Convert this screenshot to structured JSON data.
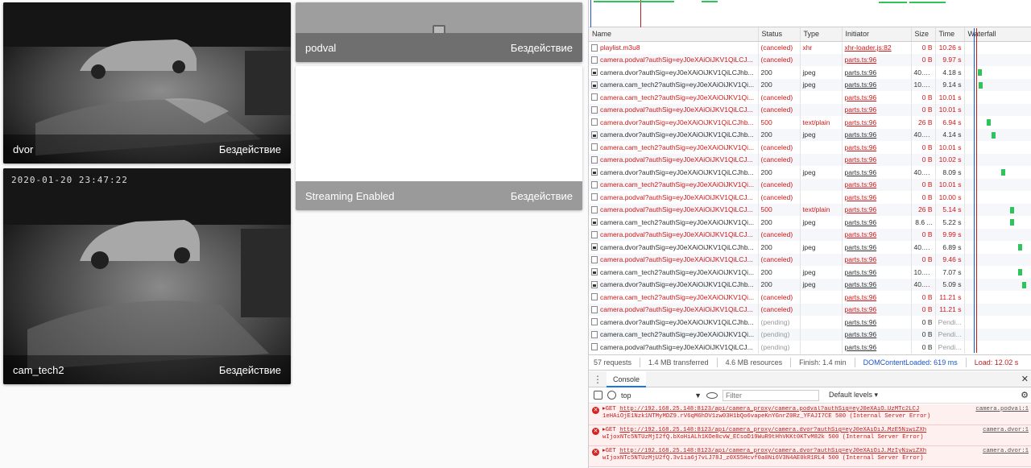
{
  "cameras": {
    "dvor": {
      "name": "dvor",
      "state": "Бездействие"
    },
    "cam_tech2": {
      "name": "cam_tech2",
      "state": "Бездействие",
      "timestamp": "2020-01-20 23:47:22"
    },
    "podval": {
      "name": "podval",
      "state": "Бездействие"
    },
    "streaming": {
      "name": "Streaming Enabled",
      "state": "Бездействие"
    }
  },
  "network": {
    "columns": [
      "Name",
      "Status",
      "Type",
      "Initiator",
      "Size",
      "Time",
      "Waterfall"
    ],
    "rows": [
      {
        "name": "playlist.m3u8",
        "status": "(canceled)",
        "type": "xhr",
        "initiator": "xhr-loader.js:82",
        "size": "0 B",
        "time": "10.26 s",
        "error": true,
        "icon": "doc-icon",
        "bar": null
      },
      {
        "name": "camera.podval?authSig=eyJ0eXAiOiJKV1QiLCJ...",
        "status": "(canceled)",
        "type": "",
        "initiator": "parts.ts:96",
        "size": "0 B",
        "time": "9.97 s",
        "error": true,
        "icon": "doc-icon",
        "bar": null
      },
      {
        "name": "camera.dvor?authSig=eyJ0eXAiOiJKV1QiLCJhb...",
        "status": "200",
        "type": "jpeg",
        "initiator": "parts.ts:96",
        "size": "40.6...",
        "time": "4.18 s",
        "error": false,
        "icon": "image-icon",
        "bar": 0.2
      },
      {
        "name": "camera.cam_tech2?authSig=eyJ0eXAiOiJKV1Qi...",
        "status": "200",
        "type": "jpeg",
        "initiator": "parts.ts:96",
        "size": "10.1...",
        "time": "9.14 s",
        "error": false,
        "icon": "image-icon",
        "bar": 0.21
      },
      {
        "name": "camera.cam_tech2?authSig=eyJ0eXAiOiJKV1Qi...",
        "status": "(canceled)",
        "type": "",
        "initiator": "parts.ts:96",
        "size": "0 B",
        "time": "10.01 s",
        "error": true,
        "icon": "doc-icon",
        "bar": null
      },
      {
        "name": "camera.podval?authSig=eyJ0eXAiOiJKV1QiLCJ...",
        "status": "(canceled)",
        "type": "",
        "initiator": "parts.ts:96",
        "size": "0 B",
        "time": "10.01 s",
        "error": true,
        "icon": "doc-icon",
        "bar": null
      },
      {
        "name": "camera.dvor?authSig=eyJ0eXAiOiJKV1QiLCJhb...",
        "status": "500",
        "type": "text/plain",
        "initiator": "parts.ts:96",
        "size": "26 B",
        "time": "6.94 s",
        "error": true,
        "icon": "doc-icon",
        "bar": 0.34
      },
      {
        "name": "camera.dvor?authSig=eyJ0eXAiOiJKV1QiLCJhb...",
        "status": "200",
        "type": "jpeg",
        "initiator": "parts.ts:96",
        "size": "40.5...",
        "time": "4.14 s",
        "error": false,
        "icon": "image-icon",
        "bar": 0.41
      },
      {
        "name": "camera.cam_tech2?authSig=eyJ0eXAiOiJKV1Qi...",
        "status": "(canceled)",
        "type": "",
        "initiator": "parts.ts:96",
        "size": "0 B",
        "time": "10.01 s",
        "error": true,
        "icon": "doc-icon",
        "bar": null
      },
      {
        "name": "camera.podval?authSig=eyJ0eXAiOiJKV1QiLCJ...",
        "status": "(canceled)",
        "type": "",
        "initiator": "parts.ts:96",
        "size": "0 B",
        "time": "10.02 s",
        "error": true,
        "icon": "doc-icon",
        "bar": null
      },
      {
        "name": "camera.dvor?authSig=eyJ0eXAiOiJKV1QiLCJhb...",
        "status": "200",
        "type": "jpeg",
        "initiator": "parts.ts:96",
        "size": "40.4...",
        "time": "8.09 s",
        "error": false,
        "icon": "image-icon",
        "bar": 0.56
      },
      {
        "name": "camera.cam_tech2?authSig=eyJ0eXAiOiJKV1Qi...",
        "status": "(canceled)",
        "type": "",
        "initiator": "parts.ts:96",
        "size": "0 B",
        "time": "10.01 s",
        "error": true,
        "icon": "doc-icon",
        "bar": null
      },
      {
        "name": "camera.podval?authSig=eyJ0eXAiOiJKV1QiLCJ...",
        "status": "(canceled)",
        "type": "",
        "initiator": "parts.ts:96",
        "size": "0 B",
        "time": "10.00 s",
        "error": true,
        "icon": "doc-icon",
        "bar": null
      },
      {
        "name": "camera.podval?authSig=eyJ0eXAiOiJKV1QiLCJ...",
        "status": "500",
        "type": "text/plain",
        "initiator": "parts.ts:96",
        "size": "26 B",
        "time": "5.14 s",
        "error": true,
        "icon": "doc-icon",
        "bar": 0.7
      },
      {
        "name": "camera.cam_tech2?authSig=eyJ0eXAiOiJKV1Qi...",
        "status": "200",
        "type": "jpeg",
        "initiator": "parts.ts:96",
        "size": "8.6 ...",
        "time": "5.22 s",
        "error": false,
        "icon": "image-icon",
        "bar": 0.7
      },
      {
        "name": "camera.podval?authSig=eyJ0eXAiOiJKV1QiLCJ...",
        "status": "(canceled)",
        "type": "",
        "initiator": "parts.ts:96",
        "size": "0 B",
        "time": "9.99 s",
        "error": true,
        "icon": "doc-icon",
        "bar": null
      },
      {
        "name": "camera.dvor?authSig=eyJ0eXAiOiJKV1QiLCJhb...",
        "status": "200",
        "type": "jpeg",
        "initiator": "parts.ts:96",
        "size": "40.5...",
        "time": "6.89 s",
        "error": false,
        "icon": "image-icon",
        "bar": 0.82
      },
      {
        "name": "camera.podval?authSig=eyJ0eXAiOiJKV1QiLCJ...",
        "status": "(canceled)",
        "type": "",
        "initiator": "parts.ts:96",
        "size": "0 B",
        "time": "9.46 s",
        "error": true,
        "icon": "doc-icon",
        "bar": null
      },
      {
        "name": "camera.cam_tech2?authSig=eyJ0eXAiOiJKV1Qi...",
        "status": "200",
        "type": "jpeg",
        "initiator": "parts.ts:96",
        "size": "10.1...",
        "time": "7.07 s",
        "error": false,
        "icon": "image-icon",
        "bar": 0.82
      },
      {
        "name": "camera.dvor?authSig=eyJ0eXAiOiJKV1QiLCJhb...",
        "status": "200",
        "type": "jpeg",
        "initiator": "parts.ts:96",
        "size": "40.4...",
        "time": "5.09 s",
        "error": false,
        "icon": "image-icon",
        "bar": 0.89
      },
      {
        "name": "camera.cam_tech2?authSig=eyJ0eXAiOiJKV1Qi...",
        "status": "(canceled)",
        "type": "",
        "initiator": "parts.ts:96",
        "size": "0 B",
        "time": "11.21 s",
        "error": true,
        "icon": "doc-icon",
        "bar": null
      },
      {
        "name": "camera.podval?authSig=eyJ0eXAiOiJKV1QiLCJ...",
        "status": "(canceled)",
        "type": "",
        "initiator": "parts.ts:96",
        "size": "0 B",
        "time": "11.21 s",
        "error": true,
        "icon": "doc-icon",
        "bar": null
      },
      {
        "name": "camera.dvor?authSig=eyJ0eXAiOiJKV1QiLCJhb...",
        "status": "(pending)",
        "type": "",
        "initiator": "parts.ts:96",
        "size": "0 B",
        "time": "Pendi...",
        "error": false,
        "pending": true,
        "icon": "doc-icon",
        "bar": null
      },
      {
        "name": "camera.cam_tech2?authSig=eyJ0eXAiOiJKV1Qi...",
        "status": "(pending)",
        "type": "",
        "initiator": "parts.ts:96",
        "size": "0 B",
        "time": "Pendi...",
        "error": false,
        "pending": true,
        "icon": "doc-icon",
        "bar": null
      },
      {
        "name": "camera.podval?authSig=eyJ0eXAiOiJKV1QiLCJ...",
        "status": "(pending)",
        "type": "",
        "initiator": "parts.ts:96",
        "size": "0 B",
        "time": "Pendi...",
        "error": false,
        "pending": true,
        "icon": "doc-icon",
        "bar": null
      }
    ],
    "summary": {
      "requests": "57 requests",
      "transferred": "1.4 MB transferred",
      "resources": "4.6 MB resources",
      "finish": "Finish: 1.4 min",
      "dcl": "DOMContentLoaded: 619 ms",
      "load": "Load: 12.02 s"
    }
  },
  "console": {
    "tab": "Console",
    "context": "top",
    "filter_placeholder": "Filter",
    "levels": "Default levels",
    "messages": [
      {
        "prefix": "▸GET ",
        "url": "http://192.168.25.148:8123/api/camera_proxy/camera.podval?authSig=eyJ0eXAiO…UzMTc2LCJ",
        "tail": "1eHAiOjE1Nzk1NTMyMDZ9.rV6qM6hDV1zw03H1bQo6vapeKnYGnrZ0Rz_YFAJI7CE 500 (Internal Server Error)",
        "source": "camera.podval:1"
      },
      {
        "prefix": "▸GET ",
        "url": "http://192.168.25.148:8123/api/camera_proxy/camera.dvor?authSig=eyJ0eXAiOiJ…MzE5NiwiZXh",
        "tail": "wIjoxNTc5NTUzMjI2fQ.bXoHiALh1KOe8cvW_ECsoD19WuR9tHhVKKt0KTvM82k 500 (Internal Server Error)",
        "source": "camera.dvor:1"
      },
      {
        "prefix": "▸GET ",
        "url": "http://192.168.25.148:8123/api/camera_proxy/camera.dvor?authSig=eyJ0eXAiOiJ…MzIyNiwiZXh",
        "tail": "wIjoxNTc5NTUzMjU2fQ.3v1ia6j7vLJ78J_z0XS5Hcvf0a0Ni6V3N4AE0kR1RL4 500 (Internal Server Error)",
        "source": "camera.dvor:1"
      }
    ]
  },
  "colors": {
    "error": "#d01818",
    "bar": "#2ec45c",
    "dcl": "#1a55c9",
    "load": "#c01d1d"
  }
}
